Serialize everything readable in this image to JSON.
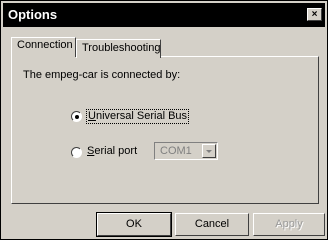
{
  "window": {
    "title": "Options",
    "close_glyph": "×"
  },
  "tabs": [
    {
      "label": "Connection",
      "active": true
    },
    {
      "label": "Troubleshooting",
      "active": false
    }
  ],
  "connection": {
    "connected_label": "The empeg-car is connected by:",
    "options": [
      {
        "label": "Universal Serial Bus",
        "underline": "U",
        "rest": "niversal Serial Bus",
        "selected": true
      },
      {
        "label": "Serial port",
        "underline": "S",
        "rest": "erial port",
        "selected": false
      }
    ],
    "port_select": {
      "value": "COM1",
      "enabled": false
    }
  },
  "buttons": {
    "ok": "OK",
    "cancel": "Cancel",
    "apply": "Apply"
  },
  "icons": {
    "close": "close-icon",
    "dropdown": "chevron-down-icon"
  }
}
